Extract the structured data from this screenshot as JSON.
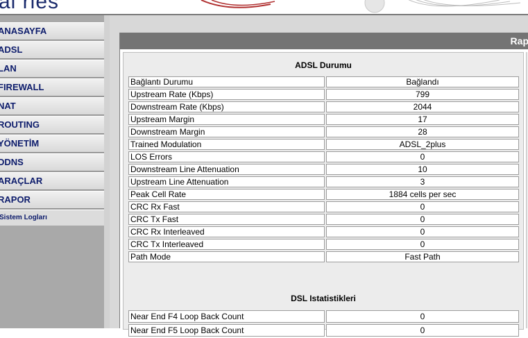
{
  "header": {
    "logo_text": "al ries"
  },
  "sidebar": {
    "items": [
      {
        "label": "ANASAYFA"
      },
      {
        "label": "ADSL"
      },
      {
        "label": "LAN"
      },
      {
        "label": "FIREWALL"
      },
      {
        "label": "NAT"
      },
      {
        "label": "ROUTING"
      },
      {
        "label": "YÖNETİM"
      },
      {
        "label": "DDNS"
      },
      {
        "label": "ARAÇLAR"
      },
      {
        "label": "RAPOR"
      }
    ],
    "subitem": {
      "label": "Sistem Logları"
    }
  },
  "panel": {
    "title": "Rapor"
  },
  "adsl": {
    "title": "ADSL Durumu",
    "rows": [
      {
        "label": "Bağlantı Durumu",
        "value": "Bağlandı"
      },
      {
        "label": "Upstream Rate (Kbps)",
        "value": "799"
      },
      {
        "label": "Downstream Rate (Kbps)",
        "value": "2044"
      },
      {
        "label": "Upstream Margin",
        "value": "17"
      },
      {
        "label": "Downstream Margin",
        "value": "28"
      },
      {
        "label": "Trained Modulation",
        "value": "ADSL_2plus"
      },
      {
        "label": "LOS Errors",
        "value": "0"
      },
      {
        "label": "Downstream Line Attenuation",
        "value": "10"
      },
      {
        "label": "Upstream Line Attenuation",
        "value": "3"
      },
      {
        "label": "Peak Cell Rate",
        "value": "1884 cells per sec"
      },
      {
        "label": "CRC Rx Fast",
        "value": "0"
      },
      {
        "label": "CRC Tx Fast",
        "value": "0"
      },
      {
        "label": "CRC Rx Interleaved",
        "value": "0"
      },
      {
        "label": "CRC Tx Interleaved",
        "value": "0"
      },
      {
        "label": "Path Mode",
        "value": "Fast Path"
      }
    ]
  },
  "dsl": {
    "title": "DSL Istatistikleri",
    "rows": [
      {
        "label": "Near End F4 Loop Back Count",
        "value": "0"
      },
      {
        "label": "Near End F5 Loop Back Count",
        "value": "0"
      }
    ]
  }
}
